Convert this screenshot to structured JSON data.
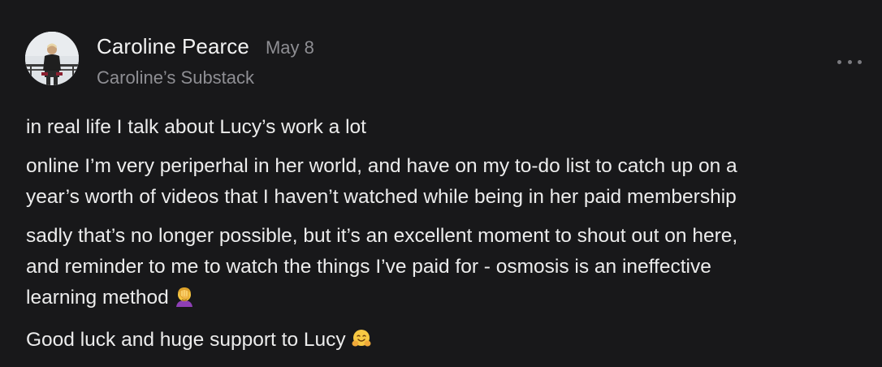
{
  "note": {
    "author": "Caroline Pearce",
    "date": "May 8",
    "publication": "Caroline’s Substack",
    "more_icon": "ellipsis-icon",
    "avatar_icon": "avatar",
    "paragraphs": [
      "in real life I talk about Lucy’s work a lot",
      "online I’m very periperhal in her world, and have on my to-do list to catch up on a\nyear’s worth of videos that I haven’t watched while being in her paid membership",
      "sadly that’s no longer possible, but it’s an excellent moment to shout out on here,\nand reminder to me to watch the things I’ve paid for - osmosis is an ineffective\nlearning method",
      "Good luck and huge support to Lucy"
    ],
    "emojis": [
      {
        "name": "facepalm-emoji"
      },
      {
        "name": "hugging-face-emoji"
      }
    ]
  }
}
